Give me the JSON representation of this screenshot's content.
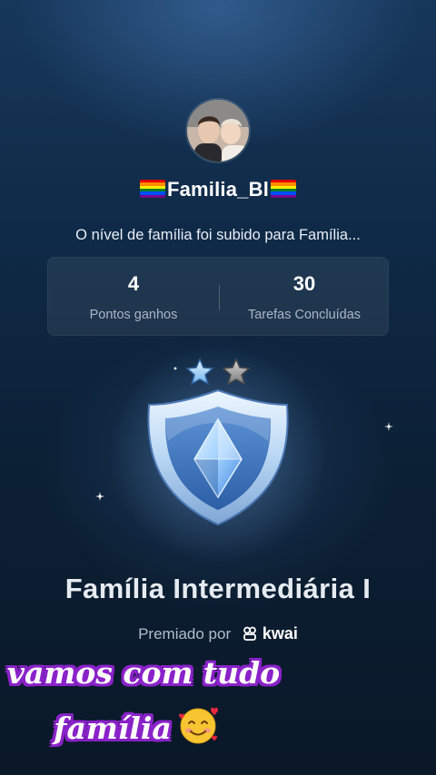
{
  "profile": {
    "username": "Familia_Bl",
    "avatar_alt": "avatar"
  },
  "level_message": "O nível de família foi subido para Família...",
  "stats": [
    {
      "value": "4",
      "label": "Pontos ganhos"
    },
    {
      "value": "30",
      "label": "Tarefas Concluídas"
    }
  ],
  "badge": {
    "title": "Família Intermediária I",
    "stars_filled": 1,
    "stars_total": 2
  },
  "awarded": {
    "prefix": "Premiado por",
    "brand": "kwai"
  },
  "caption": {
    "line1": "vamos com tudo",
    "line2": "família",
    "emoji": "smiling-face-with-hearts"
  },
  "colors": {
    "caption_outline": "#8a22c9",
    "badge_blue": "#7fb6f0"
  }
}
